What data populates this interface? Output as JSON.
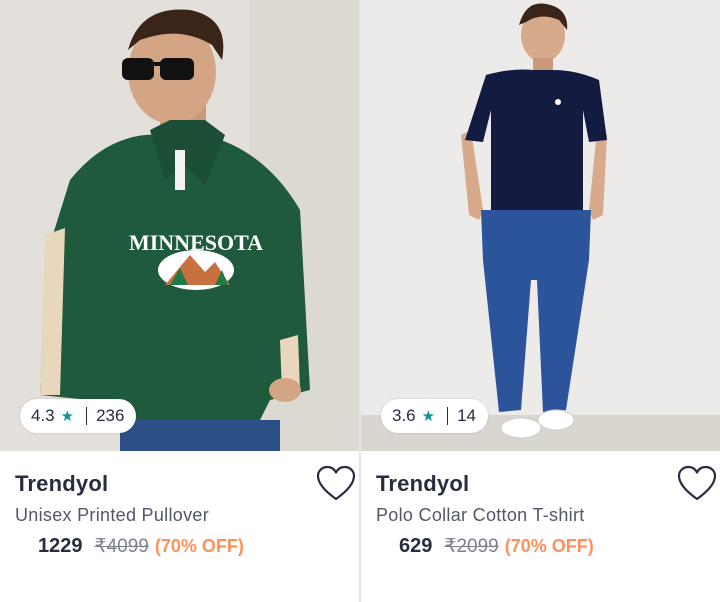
{
  "products": [
    {
      "brand": "Trendyol",
      "title": "Unisex Printed Pullover",
      "price": "1229",
      "mrp": "₹4099",
      "discount": "(70% OFF)",
      "rating": "4.3",
      "rating_count": "236",
      "image_text": "MINNESOTA",
      "image_colors": {
        "background": "#e3e0dc",
        "garment": "#1f5a3c",
        "accent": "#e8d7bd"
      }
    },
    {
      "brand": "Trendyol",
      "title": "Polo Collar Cotton T-shirt",
      "price": "629",
      "mrp": "₹2099",
      "discount": "(70% OFF)",
      "rating": "3.6",
      "rating_count": "14",
      "image_colors": {
        "background": "#ecebe9",
        "garment": "#141b40",
        "jeans": "#2b549a"
      }
    }
  ],
  "colors": {
    "star": "#14958f",
    "discount": "#ff905a",
    "text": "#282c3f",
    "muted": "#535766"
  },
  "icons": {
    "rating": "star-icon",
    "wishlist": "heart-icon"
  }
}
